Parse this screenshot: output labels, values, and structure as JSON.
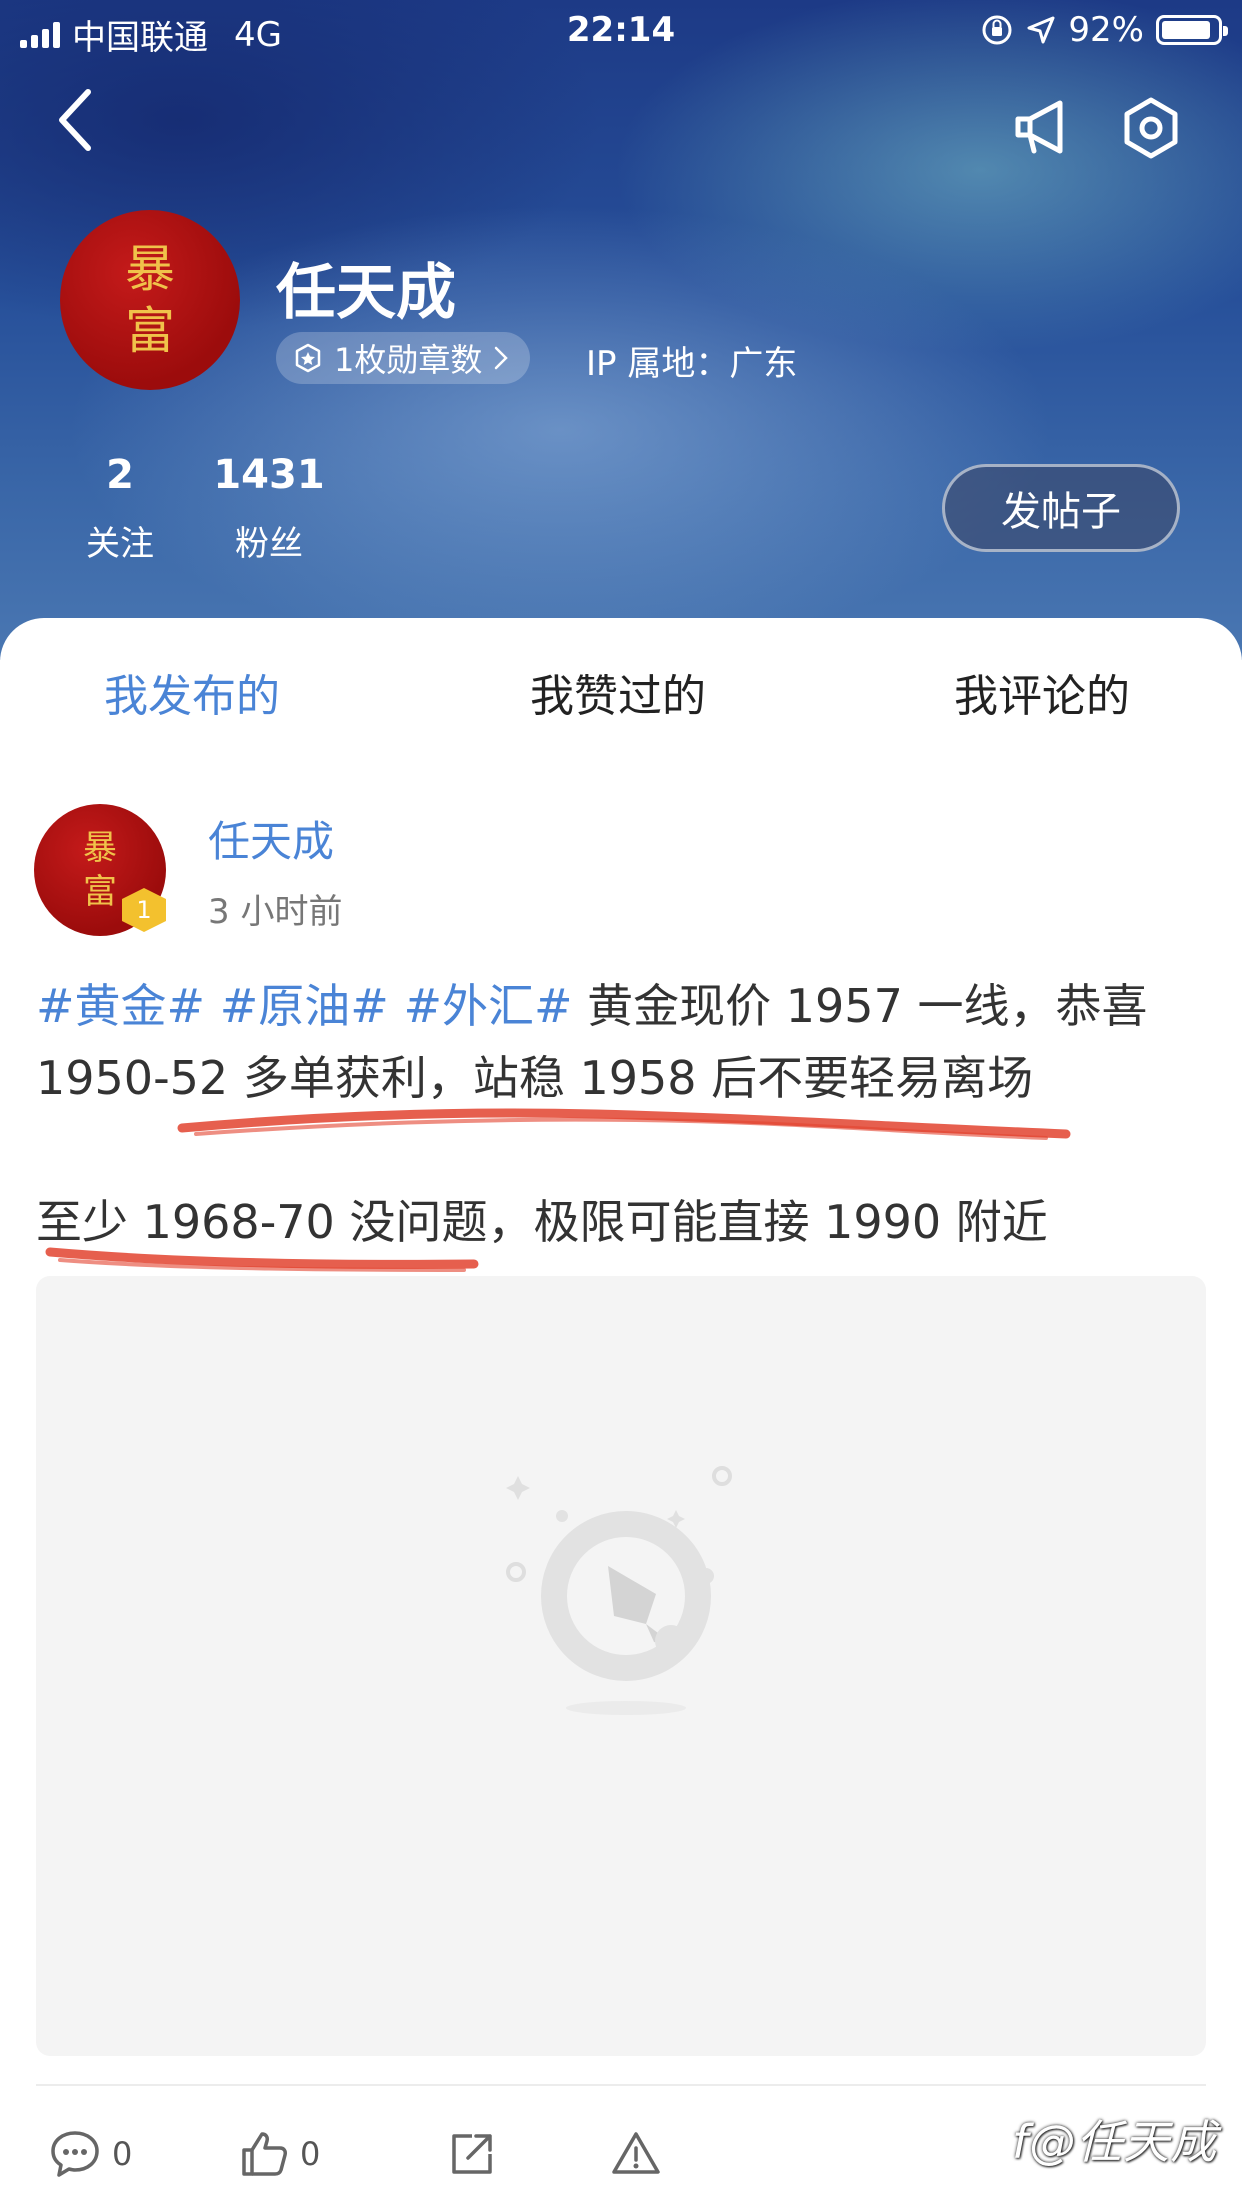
{
  "status_bar": {
    "carrier": "中国联通",
    "network": "4G",
    "time": "22:14",
    "battery": "92%"
  },
  "header": {
    "back_icon": "chevron-left-icon",
    "megaphone_icon": "megaphone-icon",
    "settings_icon": "settings-hexagon-icon"
  },
  "profile": {
    "avatar_text_top": "暴",
    "avatar_text_bottom": "富",
    "name": "任天成",
    "medal_count": "1枚勋章数",
    "ip_location": "IP 属地：广东",
    "following_count": "2",
    "following_label": "关注",
    "followers_count": "1431",
    "followers_label": "粉丝",
    "post_button": "发帖子"
  },
  "tabs": [
    {
      "label": "我发布的",
      "active": true
    },
    {
      "label": "我赞过的",
      "active": false
    },
    {
      "label": "我评论的",
      "active": false
    }
  ],
  "post": {
    "author": "任天成",
    "time": "3 小时前",
    "level": "1",
    "tags": [
      "#黄金#",
      "#原油#",
      "#外汇#"
    ],
    "line1_rest": "黄金现价 1957 一线，恭喜",
    "line2": "1950-52 多单获利，站稳 1958 后不要轻易离场",
    "line3": "至少 1968-70 没问题，极限可能直接 1990 附近",
    "comment_count": "0",
    "like_count": "0"
  },
  "watermark": "f@任天成",
  "colors": {
    "accent_blue": "#4a84d6",
    "avatar_red": "#9c0c0c",
    "avatar_gold": "#f0c24a",
    "scribble_red": "#e2432f",
    "level_badge": "#f3c12e"
  }
}
